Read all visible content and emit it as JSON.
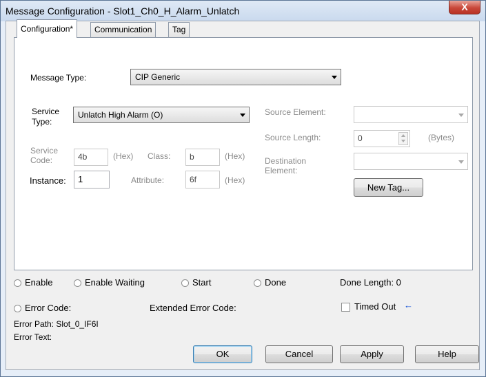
{
  "window": {
    "title": "Message Configuration - Slot1_Ch0_H_Alarm_Unlatch",
    "close_glyph": "X"
  },
  "tabs": [
    {
      "label": "Configuration*",
      "active": true
    },
    {
      "label": "Communication",
      "active": false
    },
    {
      "label": "Tag",
      "active": false
    }
  ],
  "config": {
    "message_type_label": "Message Type:",
    "message_type_value": "CIP Generic",
    "service_type_label_1": "Service",
    "service_type_label_2": "Type:",
    "service_type_value": "Unlatch High Alarm (O)",
    "service_code_label_1": "Service",
    "service_code_label_2": "Code:",
    "service_code_value": "4b",
    "hex_1": "(Hex)",
    "class_label": "Class:",
    "class_value": "b",
    "hex_2": "(Hex)",
    "instance_label": "Instance:",
    "instance_value": "1",
    "attribute_label": "Attribute:",
    "attribute_value": "6f",
    "hex_3": "(Hex)",
    "source_element_label": "Source Element:",
    "source_element_value": "",
    "source_length_label": "Source Length:",
    "source_length_value": "0",
    "bytes_label": "(Bytes)",
    "destination_label_1": "Destination",
    "destination_label_2": "Element:",
    "destination_value": "",
    "new_tag_label": "New Tag..."
  },
  "status": {
    "enable": "Enable",
    "enable_waiting": "Enable Waiting",
    "start": "Start",
    "done": "Done",
    "done_length": "Done Length: 0",
    "error_code": "Error Code:",
    "extended_error_code": "Extended Error Code:",
    "timed_out": "Timed Out",
    "timed_out_arrow": "←",
    "error_path": "Error Path: Slot_0_IF6I",
    "error_text": "Error Text:"
  },
  "buttons": {
    "ok": "OK",
    "cancel": "Cancel",
    "apply": "Apply",
    "help": "Help"
  }
}
